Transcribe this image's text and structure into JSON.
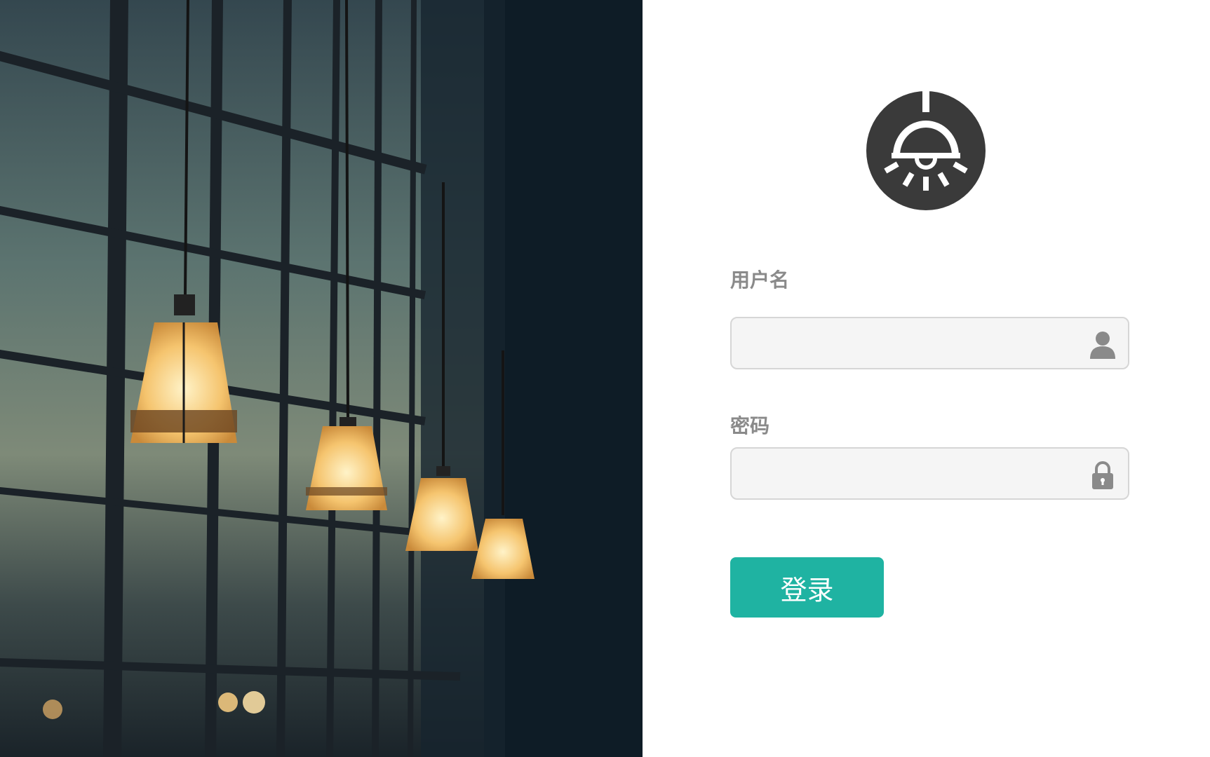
{
  "form": {
    "username_label": "用户名",
    "username_value": "",
    "username_placeholder": "",
    "password_label": "密码",
    "password_value": "",
    "password_placeholder": "",
    "submit_label": "登录"
  },
  "icons": {
    "logo": "pendant-lamp-logo",
    "username": "user-icon",
    "password": "lock-icon"
  },
  "colors": {
    "accent": "#1fb3a2",
    "logo": "#3a3a3a",
    "field_background": "#f5f5f5",
    "field_border": "#d6d6d6",
    "label": "#8a8a8a"
  }
}
